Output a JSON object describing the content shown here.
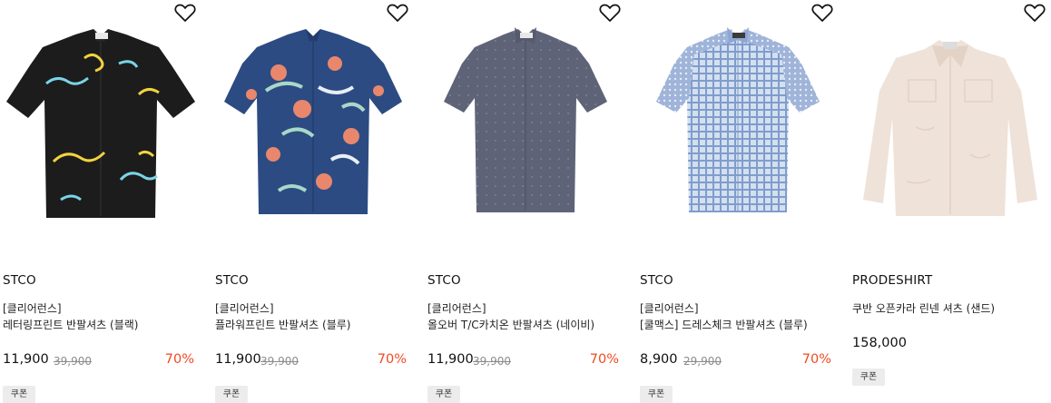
{
  "products": [
    {
      "brand": "STCO",
      "tag": "[클리어런스]",
      "name": "레터링프린트 반팔셔츠 (블랙)",
      "price": "11,900",
      "original_price": "39,900",
      "discount": "70%",
      "coupon": "쿠폰",
      "icon": "heart-outline-icon",
      "shirt_color": "#1c1c1c"
    },
    {
      "brand": "STCO",
      "tag": "[클리어런스]",
      "name": "플라워프린트 반팔셔츠 (블루)",
      "price": "11,900",
      "original_price": "39,900",
      "discount": "70%",
      "coupon": "쿠폰",
      "icon": "heart-outline-icon",
      "shirt_color": "#2c4b82"
    },
    {
      "brand": "STCO",
      "tag": "[클리어런스]",
      "name": "올오버 T/C카치온 반팔셔츠 (네이비)",
      "price": "11,900",
      "original_price": "39,900",
      "discount": "70%",
      "coupon": "쿠폰",
      "icon": "heart-outline-icon",
      "shirt_color": "#5f6378"
    },
    {
      "brand": "STCO",
      "tag": "[클리어런스]",
      "name": "[쿨맥스] 드레스체크 반팔셔츠 (블루)",
      "price": "8,900",
      "original_price": "29,900",
      "discount": "70%",
      "coupon": "쿠폰",
      "icon": "heart-outline-icon",
      "shirt_color": "#b9c9e3"
    },
    {
      "brand": "PRODESHIRT",
      "name": "쿠반 오픈카라 린넨 셔츠 (샌드)",
      "price": "158,000",
      "coupon": "쿠폰",
      "icon": "heart-outline-icon",
      "shirt_color": "#efe2d8"
    }
  ],
  "colors": {
    "discount": "#ef4a23",
    "original_price": "#8c8c8c",
    "coupon_bg": "#ececec"
  }
}
